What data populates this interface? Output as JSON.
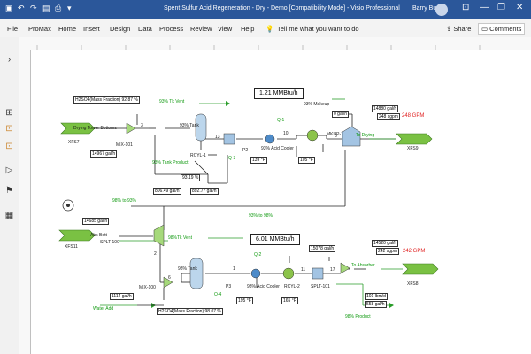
{
  "titlebar": {
    "qa_save_icon": "save-icon",
    "qa_undo_icon": "undo-icon",
    "qa_redo_icon": "redo-icon",
    "title": "Spent Sulfur Acid Regeneration - Dry - Demo  [Compatibility Mode]  -  Visio Professional",
    "user": "Barry Burr",
    "min": "—",
    "max": "❐",
    "close": "✕"
  },
  "ribbon": {
    "tabs": [
      "File",
      "ProMax",
      "Home",
      "Insert",
      "Design",
      "Data",
      "Process",
      "Review",
      "View",
      "Help"
    ],
    "tell_me": "Tell me what you want to do",
    "share": "Share",
    "comments": "Comments"
  },
  "diagram": {
    "top": {
      "energy": "1.21 MMBtu/h",
      "labels": {
        "h2so4_box": "H2SO4(Mass Fraction)  92.87 %",
        "drying_tower": "Drying Tower Bottoms",
        "xfs7": "XFS7",
        "flow1": "14967 gal/h",
        "mix101": "MIX-101",
        "tk_vent": "93% Tk Vent",
        "tank93": "93% Tank",
        "tank_product": "93% Tank Product",
        "rcyl1": "RCYL-1",
        "p2": "P2",
        "q3": "Q-3",
        "q1": "Q-1",
        "acid_cooler": "93% Acid Cooler",
        "temp1": "139 °F",
        "temp2": "105 °F",
        "makeup": "93% Makeup",
        "zero_galh": "0  gal/h",
        "mkup1": "MKUP-1",
        "to_drying": "To Drying",
        "gph_top": "14880  gal/h",
        "gpm_top": "248  sgpm",
        "red_top": "248 GPM",
        "xfs9": "XFS9",
        "stream3": "3",
        "stream13": "13",
        "stream10": "10",
        "stream5": "5",
        "pct": "93.19  %",
        "flow_806": "806.49  gal/h",
        "flow_892": "892.77  gal/h",
        "s98to93": "98% to 93%",
        "s93to98": "93% to 98%"
      }
    },
    "bottom": {
      "energy": "6.01 MMBtu/h",
      "labels": {
        "flow_14685": "14685  gal/h",
        "abs_bott": "Abs Bott",
        "xfs11": "XFS11",
        "splt100": "SPLT-100",
        "tk_vent98": "98%Tk Vent",
        "tank98": "98% Tank",
        "mix100": "MIX-100",
        "p3": "P3",
        "q4": "Q-4",
        "acid_cooler98": "98% Acid Cooler",
        "q2": "Q-2",
        "rcyl2": "RCYL-2",
        "temp3": "195 °F",
        "temp4": "165 °F",
        "flow_15078": "15078  gal/h",
        "splt101": "SPLT-101",
        "to_absorber": "To Absorber",
        "gph_bot": "14520  gal/h",
        "gpm_bot": "242  sgpm",
        "red_bot": "242 GPM",
        "xfs8": "XFS8",
        "product98": "98% Product",
        "lbm": "101  lbm/d",
        "flow_558": "558  gal/h",
        "water_flow": "1114  gal/h",
        "water_add": "Water Add",
        "h2so4_bot": "H2SO4(Mass Fraction)  98.07 %",
        "s1": "1",
        "s6": "6",
        "s11": "11",
        "s17": "17",
        "s2": "2"
      }
    }
  },
  "leftpane": [
    "chevron-right-icon",
    "pages-icon",
    "shapes-icon",
    "shapes2-icon",
    "stream-icon",
    "flag-icon",
    "grid-icon"
  ]
}
